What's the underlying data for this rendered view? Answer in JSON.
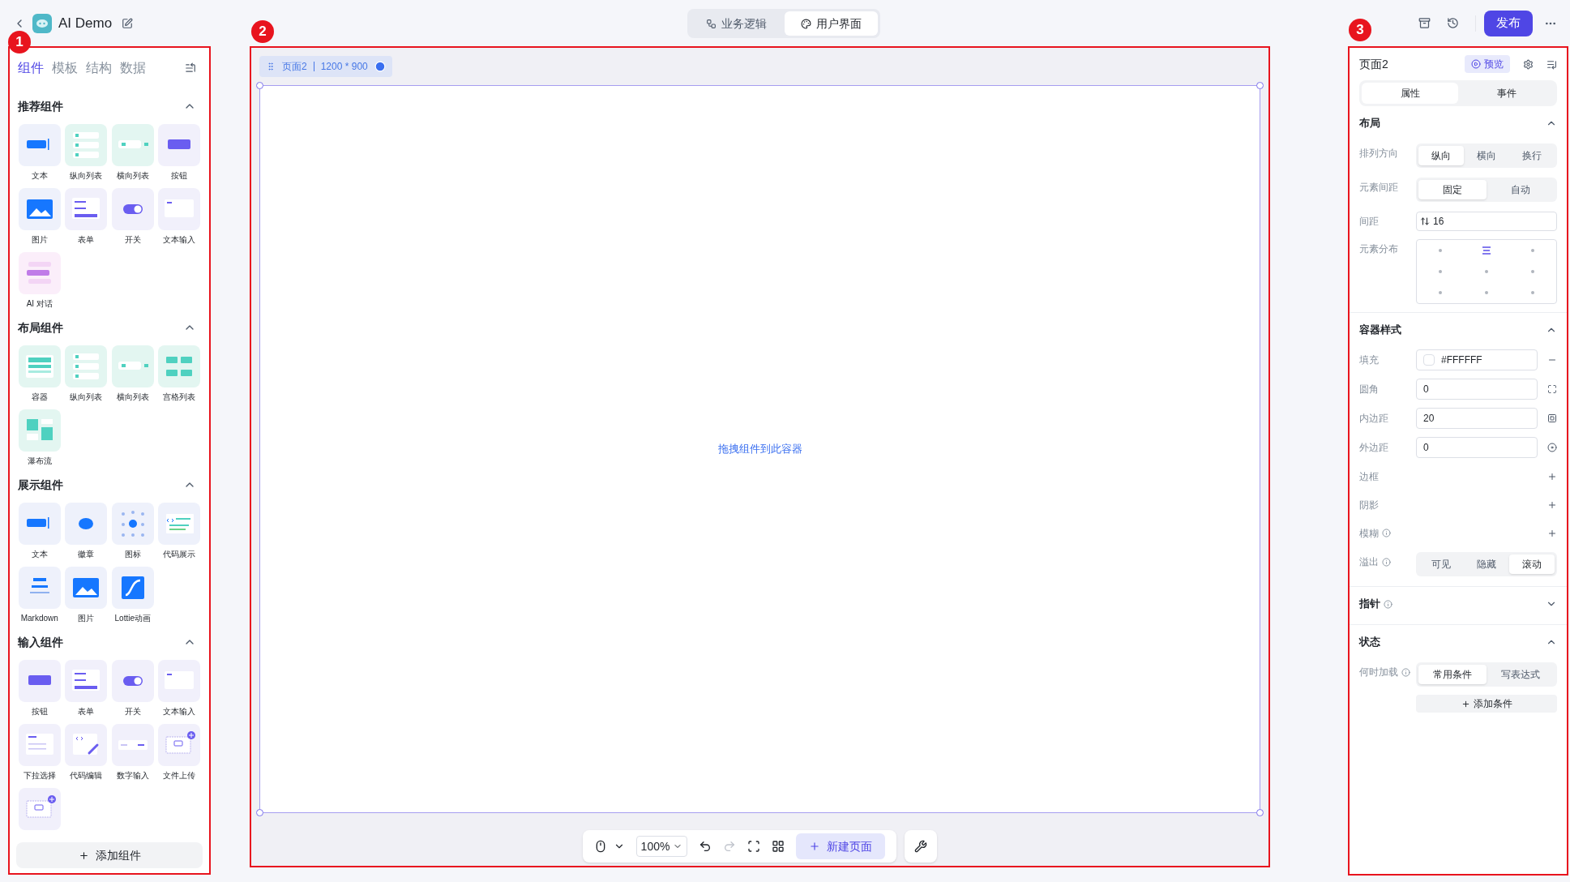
{
  "app": {
    "title": "AI Demo"
  },
  "mode_tabs": [
    {
      "label": "业务逻辑",
      "selected": false
    },
    {
      "label": "用户界面",
      "selected": true
    }
  ],
  "publish_button": "发布",
  "annotations": [
    "1",
    "2",
    "3"
  ],
  "left_panel": {
    "tabs": [
      {
        "label": "组件",
        "selected": true
      },
      {
        "label": "模板",
        "selected": false
      },
      {
        "label": "结构",
        "selected": false
      },
      {
        "label": "数据",
        "selected": false
      }
    ],
    "sections": [
      {
        "title": "推荐组件",
        "expanded": true,
        "items": [
          {
            "label": "文本",
            "kind": "text"
          },
          {
            "label": "纵向列表",
            "kind": "vlist"
          },
          {
            "label": "横向列表",
            "kind": "hlist"
          },
          {
            "label": "按钮",
            "kind": "button"
          },
          {
            "label": "图片",
            "kind": "image"
          },
          {
            "label": "表单",
            "kind": "form"
          },
          {
            "label": "开关",
            "kind": "switch"
          },
          {
            "label": "文本输入",
            "kind": "input"
          },
          {
            "label": "AI 对话",
            "kind": "chat"
          }
        ]
      },
      {
        "title": "布局组件",
        "expanded": true,
        "items": [
          {
            "label": "容器",
            "kind": "container"
          },
          {
            "label": "纵向列表",
            "kind": "vlist"
          },
          {
            "label": "横向列表",
            "kind": "hlist"
          },
          {
            "label": "宫格列表",
            "kind": "grid"
          },
          {
            "label": "瀑布流",
            "kind": "waterfall"
          }
        ]
      },
      {
        "title": "展示组件",
        "expanded": true,
        "items": [
          {
            "label": "文本",
            "kind": "text"
          },
          {
            "label": "徽章",
            "kind": "badge"
          },
          {
            "label": "图标",
            "kind": "icons"
          },
          {
            "label": "代码展示",
            "kind": "code"
          },
          {
            "label": "Markdown",
            "kind": "markdown"
          },
          {
            "label": "图片",
            "kind": "image"
          },
          {
            "label": "Lottie动画",
            "kind": "lottie"
          }
        ]
      },
      {
        "title": "输入组件",
        "expanded": true,
        "items": [
          {
            "label": "按钮",
            "kind": "button"
          },
          {
            "label": "表单",
            "kind": "form"
          },
          {
            "label": "开关",
            "kind": "switch"
          },
          {
            "label": "文本输入",
            "kind": "input"
          },
          {
            "label": "下拉选择",
            "kind": "select"
          },
          {
            "label": "代码编辑",
            "kind": "codeedit"
          },
          {
            "label": "数字输入",
            "kind": "number"
          },
          {
            "label": "文件上传",
            "kind": "upload"
          },
          {
            "kind": "upload"
          }
        ]
      }
    ],
    "add_button": "添加组件"
  },
  "canvas": {
    "page_label": "页面2",
    "size": "1200 * 900",
    "drop_hint": "拖拽组件到此容器"
  },
  "toolbar": {
    "zoom": "100%",
    "new_page": "新建页面"
  },
  "right_panel": {
    "title": "页面2",
    "preview": "预览",
    "tabs": [
      {
        "label": "属性",
        "selected": true
      },
      {
        "label": "事件",
        "selected": false
      }
    ],
    "sections": [
      {
        "title": "布局",
        "expanded": true,
        "rows": [
          {
            "kind": "segmented",
            "label": "排列方向",
            "options": [
              {
                "label": "纵向",
                "selected": true
              },
              {
                "label": "横向",
                "selected": false
              },
              {
                "label": "换行",
                "selected": false
              }
            ]
          },
          {
            "kind": "segmented",
            "label": "元素间距",
            "options": [
              {
                "label": "固定",
                "selected": true
              },
              {
                "label": "自动",
                "selected": false
              }
            ]
          },
          {
            "kind": "spacing",
            "label": "间距",
            "value": "16"
          },
          {
            "kind": "align",
            "label": "元素分布",
            "cells": [
              {
                "selected": false
              },
              {
                "selected": true
              },
              {
                "selected": false
              },
              {
                "selected": false
              },
              {
                "selected": false
              },
              {
                "selected": false
              },
              {
                "selected": false
              },
              {
                "selected": false
              },
              {
                "selected": false
              }
            ]
          }
        ]
      },
      {
        "title": "容器样式",
        "expanded": true,
        "rows": [
          {
            "kind": "color",
            "label": "填充",
            "value": "#FFFFFF"
          },
          {
            "kind": "radius",
            "label": "圆角",
            "value": "0"
          },
          {
            "kind": "padding",
            "label": "内边距",
            "value": "20"
          },
          {
            "kind": "margin",
            "label": "外边距",
            "value": "0"
          },
          {
            "kind": "add",
            "label": "边框"
          },
          {
            "kind": "add",
            "label": "阴影"
          },
          {
            "kind": "add",
            "label": "模糊",
            "info": true
          },
          {
            "kind": "segmented",
            "label": "溢出",
            "info": true,
            "options": [
              {
                "label": "可见",
                "selected": false
              },
              {
                "label": "隐藏",
                "selected": false
              },
              {
                "label": "滚动",
                "selected": true
              }
            ]
          }
        ]
      },
      {
        "title": "指针",
        "info": true,
        "expanded": false
      },
      {
        "title": "状态",
        "expanded": true,
        "rows": [
          {
            "kind": "segmented",
            "label": "何时加载",
            "info": true,
            "options": [
              {
                "label": "常用条件",
                "selected": true
              },
              {
                "label": "写表达式",
                "selected": false
              }
            ]
          },
          {
            "kind": "button",
            "label": "添加条件"
          }
        ]
      }
    ]
  }
}
